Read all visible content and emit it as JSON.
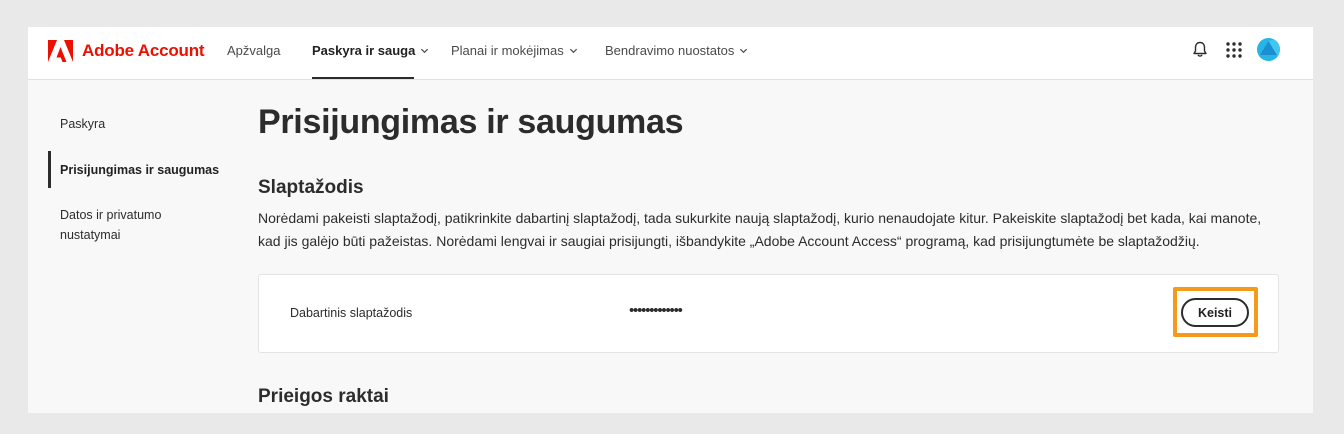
{
  "header": {
    "brand": "Adobe Account",
    "nav": [
      {
        "label": "Apžvalga"
      },
      {
        "label": "Paskyra ir sauga"
      },
      {
        "label": "Planai ir mokėjimas"
      },
      {
        "label": "Bendravimo nuostatos"
      }
    ]
  },
  "sidebar": {
    "items": [
      {
        "label": "Paskyra"
      },
      {
        "label": "Prisijungimas ir saugumas"
      },
      {
        "label": "Datos ir privatumo nustatymai"
      }
    ]
  },
  "main": {
    "title": "Prisijungimas ir saugumas",
    "password_section": {
      "title": "Slaptažodis",
      "description": "Norėdami pakeisti slaptažodį, patikrinkite dabartinį slaptažodį, tada sukurkite naują slaptažodį, kurio nenaudojate kitur. Pakeiskite slaptažodį bet kada, kai manote, kad jis galėjo būti pažeistas. Norėdami lengvai ir saugiai prisijungti, išbandykite „Adobe Account Access“ programą, kad prisijungtumėte be slaptažodžių.",
      "current_label": "Dabartinis slaptažodis",
      "current_value": "•••••••••••••",
      "change_button": "Keisti"
    },
    "passkeys_section": {
      "title": "Prieigos raktai"
    }
  },
  "colors": {
    "brand": "#eb1000",
    "highlight": "#f59b1b",
    "avatar": "#27b5e6"
  },
  "icons": [
    "adobe-logo-icon",
    "chevron-down-icon",
    "bell-icon",
    "apps-grid-icon",
    "avatar"
  ]
}
